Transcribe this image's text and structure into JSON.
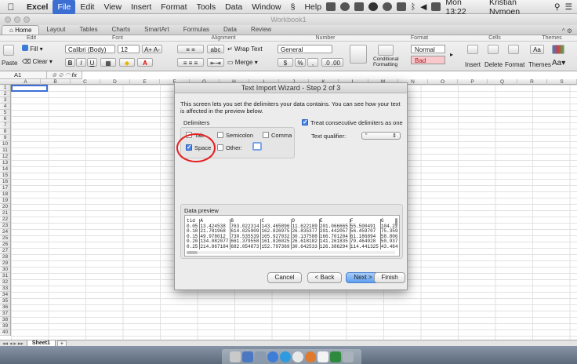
{
  "menubar": {
    "app": "Excel",
    "items": [
      "File",
      "Edit",
      "View",
      "Insert",
      "Format",
      "Tools",
      "Data",
      "Window",
      "Help"
    ],
    "active_item": "File",
    "clock": "Mon 13:22",
    "user": "Kristian Nymoen"
  },
  "window": {
    "title": "Workbook1"
  },
  "ribbon": {
    "tabs": [
      "Home",
      "Layout",
      "Tables",
      "Charts",
      "SmartArt",
      "Formulas",
      "Data",
      "Review"
    ],
    "selected_tab": "Home",
    "groups": {
      "edit": "Edit",
      "font": "Font",
      "alignment": "Alignment",
      "number": "Number",
      "format": "Format",
      "cells": "Cells",
      "themes": "Themes"
    },
    "fill_label": "Fill",
    "clear_label": "Clear",
    "paste_label": "Paste",
    "font_name": "Calibri (Body)",
    "font_size": "12",
    "wrap_text_label": "Wrap Text",
    "merge_label": "Merge",
    "number_format": "General",
    "style_normal": "Normal",
    "style_bad": "Bad",
    "conditional_formatting": "Conditional Formatting",
    "insert_label": "Insert",
    "delete_label": "Delete",
    "format_label": "Format",
    "themes_label": "Themes"
  },
  "formula_bar": {
    "cell_ref": "A1",
    "fx": "fx"
  },
  "grid": {
    "columns": [
      "A",
      "B",
      "C",
      "D",
      "E",
      "F",
      "G",
      "H",
      "I",
      "J",
      "K",
      "L",
      "M",
      "N",
      "O",
      "P",
      "Q",
      "R",
      "S"
    ],
    "rows": [
      "1",
      "2",
      "3",
      "4",
      "5",
      "6",
      "7",
      "8",
      "9",
      "10",
      "11",
      "12",
      "13",
      "14",
      "15",
      "16",
      "17",
      "18",
      "19",
      "20",
      "21",
      "22",
      "23",
      "24",
      "25",
      "26",
      "27",
      "28",
      "29",
      "30",
      "31",
      "32",
      "33",
      "34",
      "35",
      "36",
      "37",
      "38",
      "39",
      "40"
    ]
  },
  "sheet_tabs": {
    "active": "Sheet1",
    "add": "+"
  },
  "dialog": {
    "title": "Text Import Wizard - Step 2 of 3",
    "description": "This screen lets you set the delimiters your data contains. You can see how your text is affected in the preview below.",
    "delimiters_label": "Delimiters",
    "tab": {
      "label": "Tab",
      "checked": false
    },
    "semicolon": {
      "label": "Semicolon",
      "checked": false
    },
    "comma": {
      "label": "Comma",
      "checked": false
    },
    "space": {
      "label": "Space",
      "checked": true
    },
    "other": {
      "label": "Other:",
      "checked": false
    },
    "treat_consecutive": {
      "label": "Treat consecutive delimiters as one",
      "checked": true
    },
    "text_qualifier_label": "Text qualifier:",
    "text_qualifier_value": "\"",
    "preview_label": "Data preview",
    "preview_rows": [
      [
        "tid",
        "A",
        "B",
        "C",
        "D",
        "E",
        "F",
        "G"
      ],
      [
        "0.05",
        "13.424538",
        "763.022314",
        "143.465896",
        "11.622109",
        "201.066665",
        "55.500491",
        "104.22"
      ],
      [
        "0.10",
        "21.781968",
        "614.025909",
        "162.826975",
        "26.835377",
        "201.442057",
        "56.459707",
        "75.359"
      ],
      [
        "0.15",
        "49.978012",
        "730.535539",
        "165.927032",
        "30.137588",
        "166.701204",
        "61.186894",
        "58.806"
      ],
      [
        "0.20",
        "134.082077",
        "661.379558",
        "161.826025",
        "26.618182",
        "141.261835",
        "79.464928",
        "50.937"
      ],
      [
        "0.25",
        "214.867184",
        "682.054873",
        "152.797369",
        "30.642533",
        "126.386294",
        "114.441325",
        "43.464"
      ]
    ],
    "buttons": {
      "cancel": "Cancel",
      "back": "< Back",
      "next": "Next >",
      "finish": "Finish"
    }
  }
}
